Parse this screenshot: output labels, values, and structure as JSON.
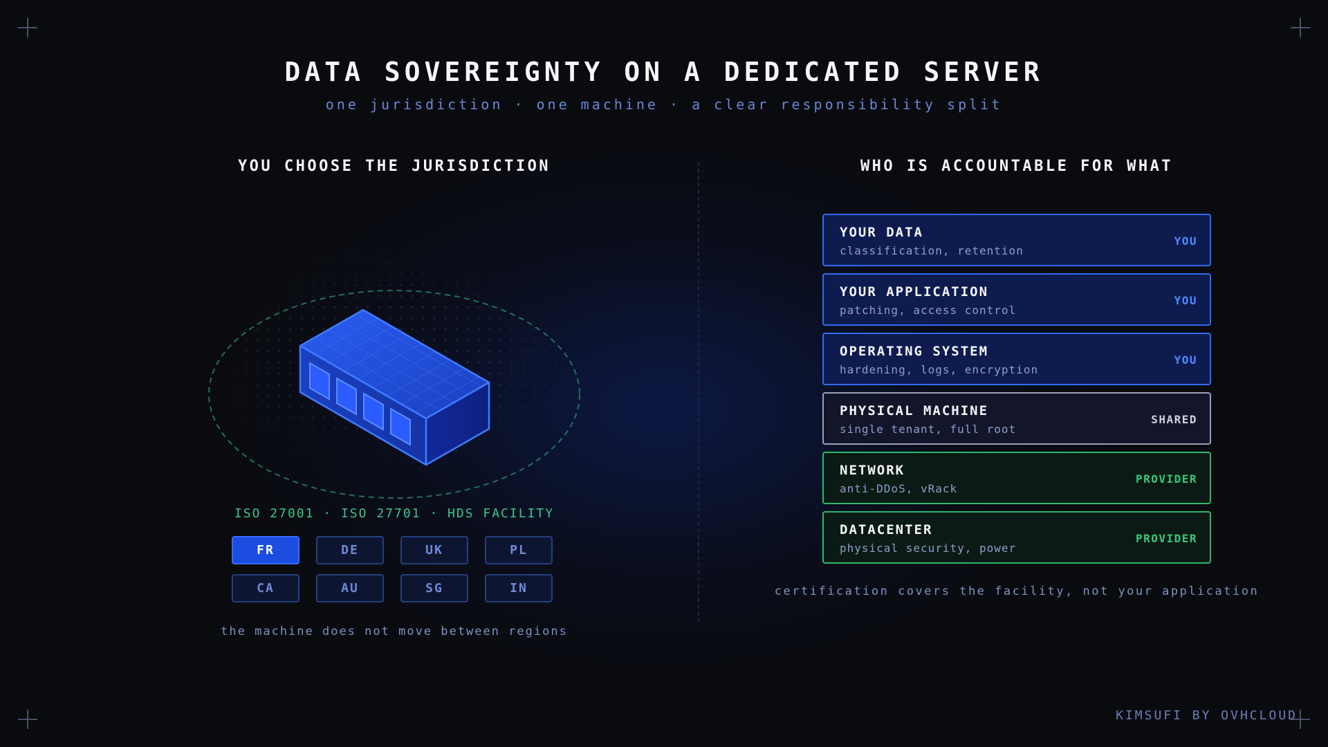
{
  "header": {
    "title": "DATA SOVEREIGNTY ON A DEDICATED SERVER",
    "subtitle": "one jurisdiction · one machine · a clear responsibility split"
  },
  "left_panel": {
    "title": "YOU CHOOSE THE JURISDICTION",
    "certifications": "ISO 27001 · ISO 27701 · HDS FACILITY",
    "regions": [
      {
        "code": "FR",
        "selected": true
      },
      {
        "code": "DE",
        "selected": false
      },
      {
        "code": "UK",
        "selected": false
      },
      {
        "code": "PL",
        "selected": false
      },
      {
        "code": "CA",
        "selected": false
      },
      {
        "code": "AU",
        "selected": false
      },
      {
        "code": "SG",
        "selected": false
      },
      {
        "code": "IN",
        "selected": false
      }
    ],
    "note": "the machine does not move between regions"
  },
  "right_panel": {
    "title": "WHO IS ACCOUNTABLE FOR WHAT",
    "layers": [
      {
        "name": "YOUR DATA",
        "detail": "classification, retention",
        "owner": "YOU"
      },
      {
        "name": "YOUR APPLICATION",
        "detail": "patching, access control",
        "owner": "YOU"
      },
      {
        "name": "OPERATING SYSTEM",
        "detail": "hardening, logs, encryption",
        "owner": "YOU"
      },
      {
        "name": "PHYSICAL MACHINE",
        "detail": "single tenant, full root",
        "owner": "SHARED"
      },
      {
        "name": "NETWORK",
        "detail": "anti-DDoS, vRack",
        "owner": "PROVIDER"
      },
      {
        "name": "DATACENTER",
        "detail": "physical security, power",
        "owner": "PROVIDER"
      }
    ],
    "note": "certification covers the facility, not your application"
  },
  "footer": {
    "brand": "KIMSUFI BY OVHCLOUD"
  },
  "colors": {
    "background": "#0a0b0f",
    "you": "#2f6cf0",
    "shared": "#9aa0b6",
    "provider": "#2fb76a",
    "selected_region": "#1a4de0"
  },
  "icons": [
    "server-isometric-icon",
    "corner-crosshair-icon"
  ]
}
